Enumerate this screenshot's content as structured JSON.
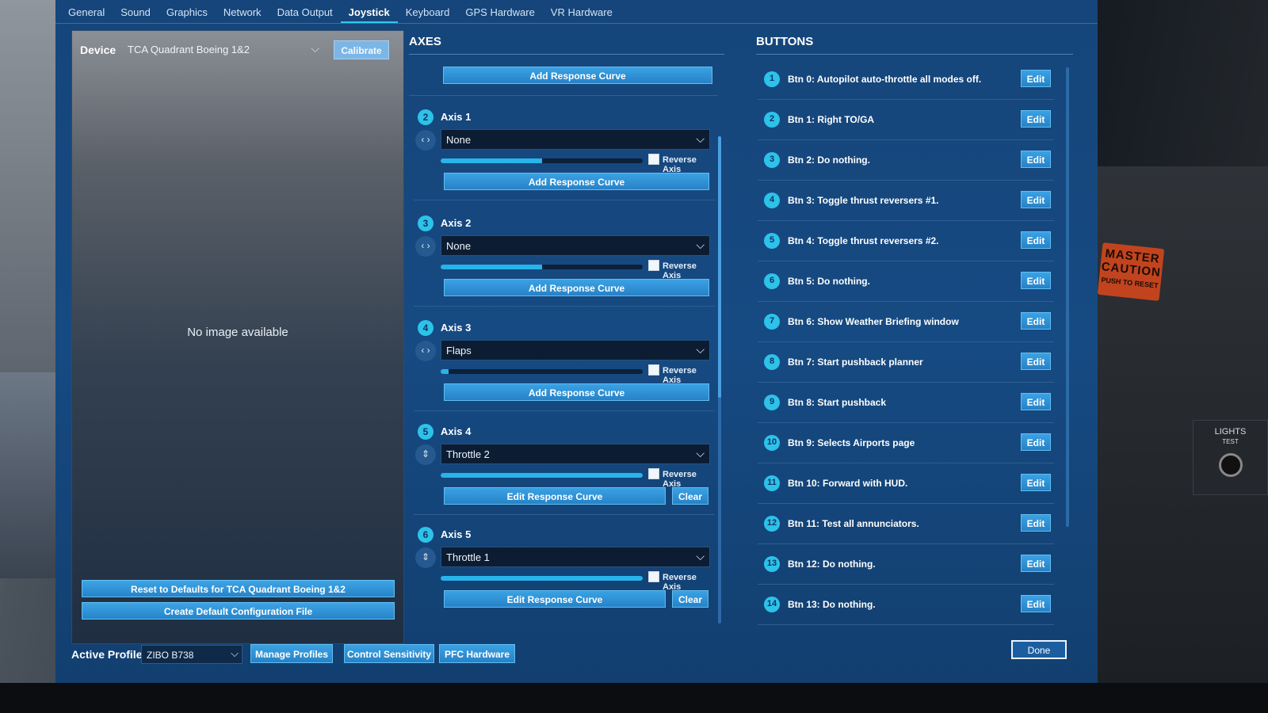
{
  "tabs": [
    {
      "label": "General"
    },
    {
      "label": "Sound"
    },
    {
      "label": "Graphics"
    },
    {
      "label": "Network"
    },
    {
      "label": "Data Output"
    },
    {
      "label": "Joystick"
    },
    {
      "label": "Keyboard"
    },
    {
      "label": "GPS Hardware"
    },
    {
      "label": "VR Hardware"
    }
  ],
  "active_tab": "Joystick",
  "device": {
    "label": "Device",
    "selected": "TCA Quadrant Boeing 1&2",
    "calibrate_label": "Calibrate",
    "no_image_text": "No image available",
    "reset_label": "Reset to Defaults for TCA Quadrant Boeing 1&2",
    "create_config_label": "Create Default Configuration File"
  },
  "axes": {
    "title": "AXES",
    "top_add_curve_label": "Add Response Curve",
    "reverse_label": "Reverse Axis",
    "items": [
      {
        "num": "2",
        "name": "Axis 1",
        "assignment": "None",
        "value_fraction": 0.5,
        "button_label": "Add Response Curve",
        "clear_label": ""
      },
      {
        "num": "3",
        "name": "Axis 2",
        "assignment": "None",
        "value_fraction": 0.5,
        "button_label": "Add Response Curve",
        "clear_label": ""
      },
      {
        "num": "4",
        "name": "Axis 3",
        "assignment": "Flaps",
        "value_fraction": 0.04,
        "button_label": "Add Response Curve",
        "clear_label": ""
      },
      {
        "num": "5",
        "name": "Axis 4",
        "assignment": "Throttle 2",
        "value_fraction": 1.0,
        "button_label": "Edit Response Curve",
        "clear_label": "Clear"
      },
      {
        "num": "6",
        "name": "Axis 5",
        "assignment": "Throttle 1",
        "value_fraction": 1.0,
        "button_label": "Edit Response Curve",
        "clear_label": "Clear"
      }
    ]
  },
  "buttons": {
    "title": "BUTTONS",
    "edit_label": "Edit",
    "items": [
      {
        "num": "1",
        "label": "Btn 0: Autopilot auto-throttle all modes off."
      },
      {
        "num": "2",
        "label": "Btn 1: Right TO/GA"
      },
      {
        "num": "3",
        "label": "Btn 2: Do nothing."
      },
      {
        "num": "4",
        "label": "Btn 3: Toggle thrust reversers #1."
      },
      {
        "num": "5",
        "label": "Btn 4: Toggle thrust reversers #2."
      },
      {
        "num": "6",
        "label": "Btn 5: Do nothing."
      },
      {
        "num": "7",
        "label": "Btn 6: Show Weather Briefing window"
      },
      {
        "num": "8",
        "label": "Btn 7: Start pushback planner"
      },
      {
        "num": "9",
        "label": "Btn 8: Start pushback"
      },
      {
        "num": "10",
        "label": "Btn 9: Selects Airports page"
      },
      {
        "num": "11",
        "label": "Btn 10: Forward with HUD."
      },
      {
        "num": "12",
        "label": "Btn 11: Test all annunciators."
      },
      {
        "num": "13",
        "label": "Btn 12: Do nothing."
      },
      {
        "num": "14",
        "label": "Btn 13: Do nothing."
      }
    ]
  },
  "footer": {
    "active_profile_label": "Active Profile",
    "profile_selected": "ZIBO B738",
    "manage_profiles_label": "Manage Profiles",
    "control_sensitivity_label": "Control Sensitivity",
    "pfc_hardware_label": "PFC Hardware",
    "done_label": "Done"
  },
  "background": {
    "caution_line1": "MASTER",
    "caution_line2": "CAUTION",
    "caution_line3": "PUSH TO RESET",
    "lights_label": "LIGHTS",
    "lights_sub": "TEST"
  },
  "colors": {
    "accent": "#2ec8ee",
    "button": "#2f8fd6",
    "window_bg": "#15457a",
    "caution": "#c2441e"
  }
}
